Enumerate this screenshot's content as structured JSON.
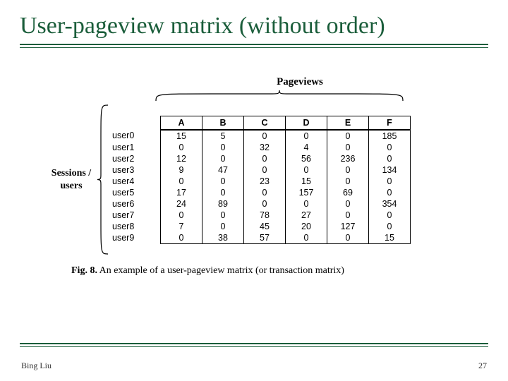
{
  "title": "User-pageview matrix (without order)",
  "pageviews_label": "Pageviews",
  "sessions_label_line1": "Sessions /",
  "sessions_label_line2": "users",
  "caption_bold": "Fig. 8.",
  "caption_rest": " An example of a user-pageview matrix (or transaction matrix)",
  "footer_author": "Bing Liu",
  "footer_page": "27",
  "chart_data": {
    "type": "table",
    "title": "User-pageview matrix",
    "columns": [
      "A",
      "B",
      "C",
      "D",
      "E",
      "F"
    ],
    "rows": [
      "user0",
      "user1",
      "user2",
      "user3",
      "user4",
      "user5",
      "user6",
      "user7",
      "user8",
      "user9"
    ],
    "values": [
      [
        15,
        5,
        0,
        0,
        0,
        185
      ],
      [
        0,
        0,
        32,
        4,
        0,
        0
      ],
      [
        12,
        0,
        0,
        56,
        236,
        0
      ],
      [
        9,
        47,
        0,
        0,
        0,
        134
      ],
      [
        0,
        0,
        23,
        15,
        0,
        0
      ],
      [
        17,
        0,
        0,
        157,
        69,
        0
      ],
      [
        24,
        89,
        0,
        0,
        0,
        354
      ],
      [
        0,
        0,
        78,
        27,
        0,
        0
      ],
      [
        7,
        0,
        45,
        20,
        127,
        0
      ],
      [
        0,
        38,
        57,
        0,
        0,
        15
      ]
    ]
  }
}
